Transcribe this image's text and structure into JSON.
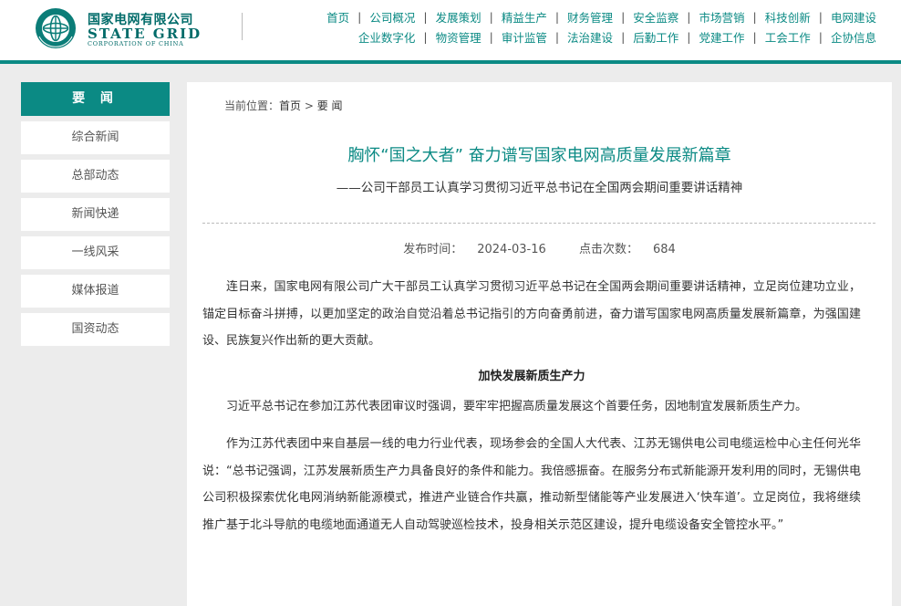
{
  "brand": {
    "name_cn": "国家电网有限公司",
    "name_en": "STATE GRID",
    "corp": "CORPORATION OF CHINA",
    "emblem_text": "STATE GRID CORPORATION OF CHINA"
  },
  "nav": {
    "row1": [
      "首页",
      "公司概况",
      "发展策划",
      "精益生产",
      "财务管理",
      "安全监察",
      "市场营销",
      "科技创新",
      "电网建设"
    ],
    "row2": [
      "企业数字化",
      "物资管理",
      "审计监管",
      "法治建设",
      "后勤工作",
      "党建工作",
      "工会工作",
      "企协信息"
    ]
  },
  "sidebar": {
    "heading": "要 闻",
    "items": [
      "综合新闻",
      "总部动态",
      "新闻快递",
      "一线风采",
      "媒体报道",
      "国资动态"
    ]
  },
  "breadcrumb": {
    "prefix": "当前位置：",
    "home": "首页",
    "sep": " > ",
    "current": "要 闻"
  },
  "article": {
    "title": "胸怀“国之大者” 奋力谱写国家电网高质量发展新篇章",
    "subtitle": "——公司干部员工认真学习贯彻习近平总书记在全国两会期间重要讲话精神",
    "publish_label": "发布时间：",
    "publish_date": "2024-03-16",
    "clicks_label": "点击次数：",
    "clicks": "684",
    "p1": "连日来，国家电网有限公司广大干部员工认真学习贯彻习近平总书记在全国两会期间重要讲话精神，立足岗位建功立业，锚定目标奋斗拼搏，以更加坚定的政治自觉沿着总书记指引的方向奋勇前进，奋力谱写国家电网高质量发展新篇章，为强国建设、民族复兴作出新的更大贡献。",
    "h1": "加快发展新质生产力",
    "p2": "习近平总书记在参加江苏代表团审议时强调，要牢牢把握高质量发展这个首要任务，因地制宜发展新质生产力。",
    "p3": "作为江苏代表团中来自基层一线的电力行业代表，现场参会的全国人大代表、江苏无锡供电公司电缆运检中心主任何光华说：“总书记强调，江苏发展新质生产力具备良好的条件和能力。我倍感振奋。在服务分布式新能源开发利用的同时，无锡供电公司积极探索优化电网消纳新能源模式，推进产业链合作共赢，推动新型储能等产业发展进入‘快车道’。立足岗位，我将继续推广基于北斗导航的电缆地面通道无人自动驾驶巡检技术，投身相关示范区建设，提升电缆设备安全管控水平。”"
  },
  "colors": {
    "brand": "#0b8a84",
    "brand_dark": "#006b69",
    "page_bg": "#ececec"
  }
}
